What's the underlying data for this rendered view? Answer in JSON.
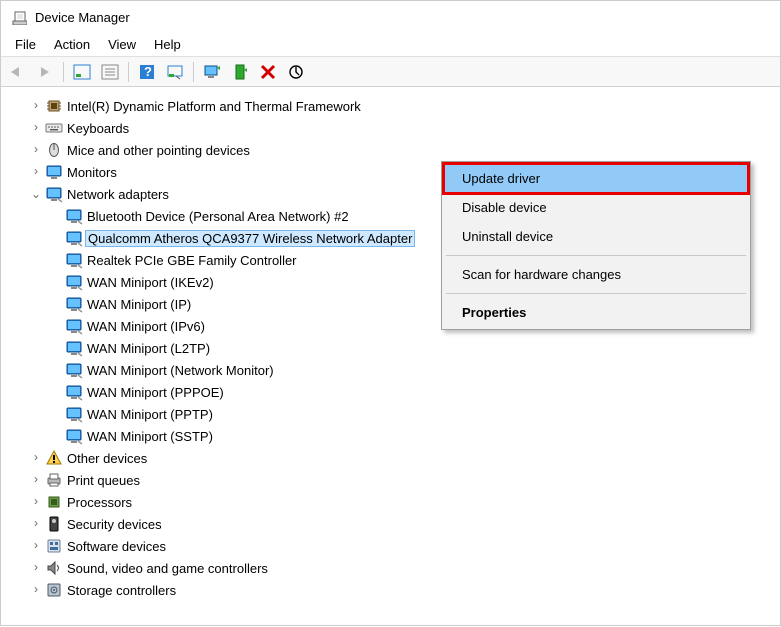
{
  "window": {
    "title": "Device Manager"
  },
  "menubar": {
    "file": "File",
    "action": "Action",
    "view": "View",
    "help": "Help"
  },
  "tree": [
    {
      "level": 1,
      "expander": ">",
      "icon": "chip",
      "label": "Intel(R) Dynamic Platform and Thermal Framework"
    },
    {
      "level": 1,
      "expander": ">",
      "icon": "keyboard",
      "label": "Keyboards"
    },
    {
      "level": 1,
      "expander": ">",
      "icon": "mouse",
      "label": "Mice and other pointing devices"
    },
    {
      "level": 1,
      "expander": ">",
      "icon": "monitor",
      "label": "Monitors"
    },
    {
      "level": 1,
      "expander": "v",
      "icon": "network",
      "label": "Network adapters"
    },
    {
      "level": 2,
      "expander": "",
      "icon": "network",
      "label": "Bluetooth Device (Personal Area Network) #2"
    },
    {
      "level": 2,
      "expander": "",
      "icon": "network",
      "label": "Qualcomm Atheros QCA9377 Wireless Network Adapter",
      "selected": true
    },
    {
      "level": 2,
      "expander": "",
      "icon": "network",
      "label": "Realtek PCIe GBE Family Controller"
    },
    {
      "level": 2,
      "expander": "",
      "icon": "network",
      "label": "WAN Miniport (IKEv2)"
    },
    {
      "level": 2,
      "expander": "",
      "icon": "network",
      "label": "WAN Miniport (IP)"
    },
    {
      "level": 2,
      "expander": "",
      "icon": "network",
      "label": "WAN Miniport (IPv6)"
    },
    {
      "level": 2,
      "expander": "",
      "icon": "network",
      "label": "WAN Miniport (L2TP)"
    },
    {
      "level": 2,
      "expander": "",
      "icon": "network",
      "label": "WAN Miniport (Network Monitor)"
    },
    {
      "level": 2,
      "expander": "",
      "icon": "network",
      "label": "WAN Miniport (PPPOE)"
    },
    {
      "level": 2,
      "expander": "",
      "icon": "network",
      "label": "WAN Miniport (PPTP)"
    },
    {
      "level": 2,
      "expander": "",
      "icon": "network",
      "label": "WAN Miniport (SSTP)"
    },
    {
      "level": 1,
      "expander": ">",
      "icon": "warn",
      "label": "Other devices"
    },
    {
      "level": 1,
      "expander": ">",
      "icon": "printer",
      "label": "Print queues"
    },
    {
      "level": 1,
      "expander": ">",
      "icon": "cpu",
      "label": "Processors"
    },
    {
      "level": 1,
      "expander": ">",
      "icon": "security",
      "label": "Security devices"
    },
    {
      "level": 1,
      "expander": ">",
      "icon": "software",
      "label": "Software devices"
    },
    {
      "level": 1,
      "expander": ">",
      "icon": "sound",
      "label": "Sound, video and game controllers"
    },
    {
      "level": 1,
      "expander": ">",
      "icon": "storage",
      "label": "Storage controllers"
    }
  ],
  "ctx": {
    "update": "Update driver",
    "disable": "Disable device",
    "uninstall": "Uninstall device",
    "scan": "Scan for hardware changes",
    "properties": "Properties"
  }
}
